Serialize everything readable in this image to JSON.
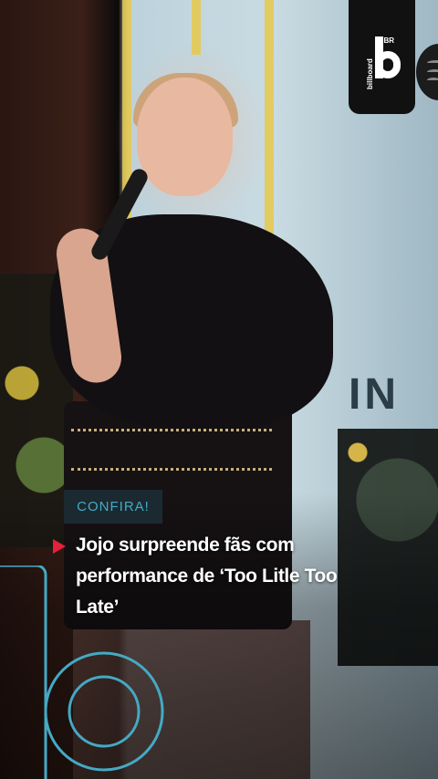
{
  "brand": {
    "logo_word": "billboard",
    "logo_region": "BR",
    "logo_glyph": "b",
    "icons": [
      "billboard-logo-icon",
      "spotify-icon",
      "play-arrow-icon",
      "outline-b-icon"
    ]
  },
  "background": {
    "banner_text": "IN"
  },
  "story": {
    "tag": "CONFIRA!",
    "headline": "Jojo surpreende fãs com performance de ‘Too Litle Too Late’"
  },
  "colors": {
    "accent_red": "#e5203a",
    "tag_text": "#45a9c5",
    "tag_bg": "#1b2a31",
    "outline_b": "#45a9c5"
  }
}
